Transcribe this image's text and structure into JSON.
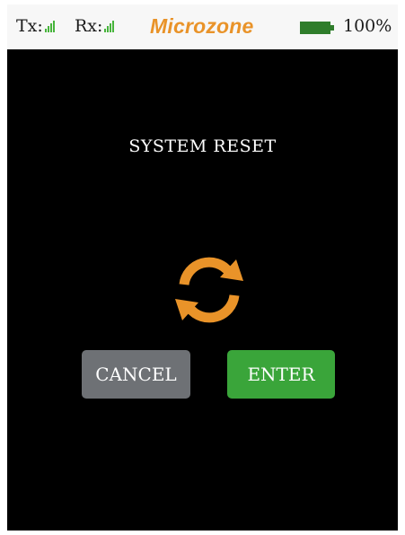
{
  "status_bar": {
    "tx_label": "Tx:",
    "rx_label": "Rx:",
    "brand": "Microzone",
    "battery_percent": "100%"
  },
  "screen": {
    "title": "SYSTEM RESET",
    "icon": "reset-refresh-icon",
    "cancel_label": "CANCEL",
    "enter_label": "ENTER"
  },
  "colors": {
    "accent_orange": "#e99329",
    "signal_green": "#47b43c",
    "battery_green": "#2f7d2b",
    "cancel_gray": "#6e7175",
    "enter_green": "#3aa53a",
    "screen_bg": "#000000"
  }
}
